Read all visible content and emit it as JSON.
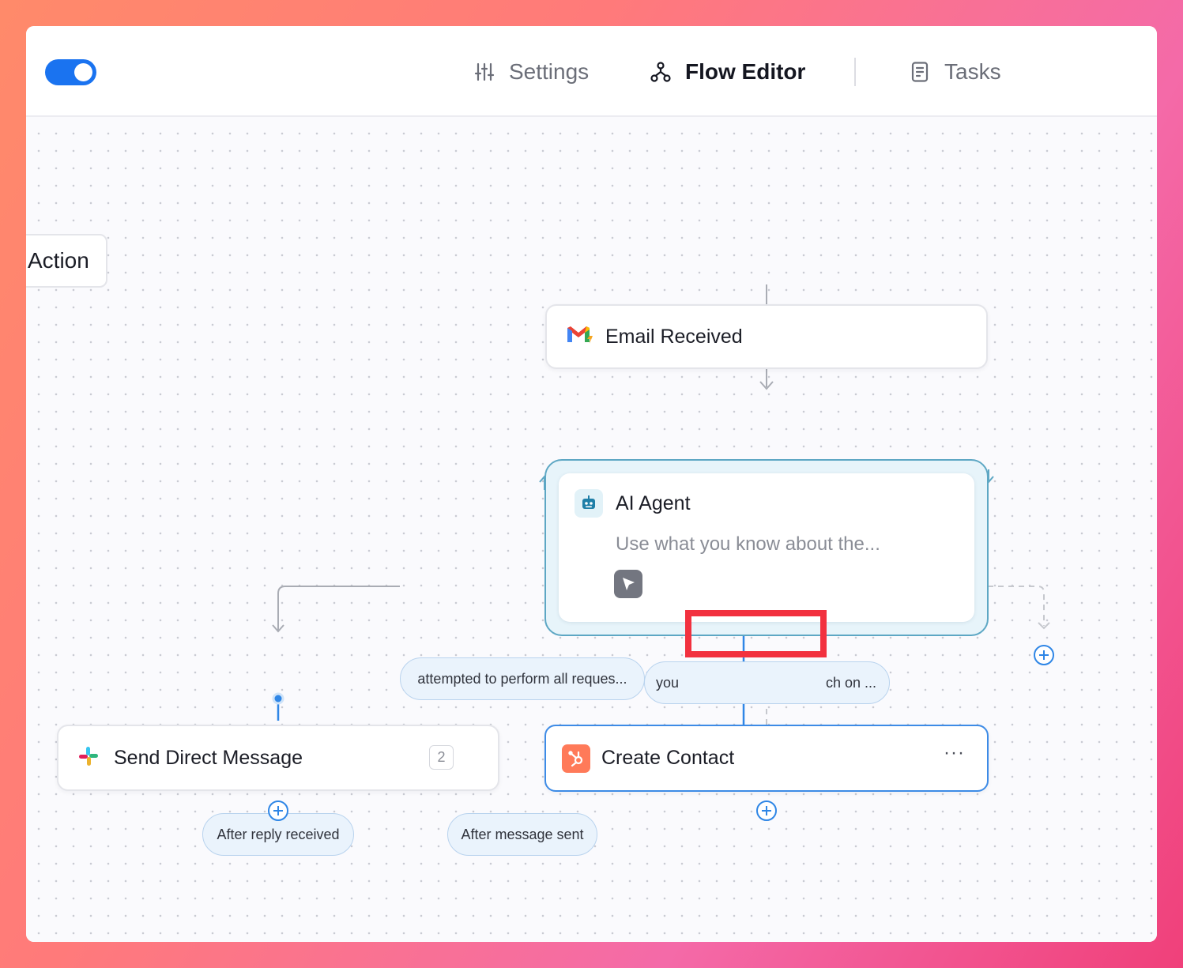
{
  "toggle": {
    "state": "on"
  },
  "nav": {
    "settings": {
      "label": "Settings",
      "icon": "sliders-icon"
    },
    "flow_editor": {
      "label": "Flow Editor",
      "icon": "flow-icon"
    },
    "tasks": {
      "label": "Tasks",
      "icon": "document-icon"
    }
  },
  "canvas": {
    "action_chip": "Action",
    "nodes": {
      "email": {
        "title": "Email Received",
        "icon": "gmail-icon"
      },
      "agent": {
        "title": "AI Agent",
        "description": "Use what you know about the...",
        "icon": "robot-icon",
        "tool_icon": "cursor-icon"
      },
      "slack": {
        "title": "Send Direct Message",
        "count": "2",
        "icon": "slack-icon"
      },
      "contact": {
        "title": "Create Contact",
        "more": "···",
        "icon": "hubspot-icon"
      }
    },
    "branches": {
      "attempted": "attempted to perform all reques...",
      "you_left": "you",
      "you_right": "ch on ...",
      "after_reply": "After reply received",
      "after_sent": "After message sent"
    }
  },
  "colors": {
    "accent": "#1a73f0",
    "connector_active": "#2f86e6",
    "highlight": "#f2313f",
    "hubspot": "#ff7a59"
  }
}
